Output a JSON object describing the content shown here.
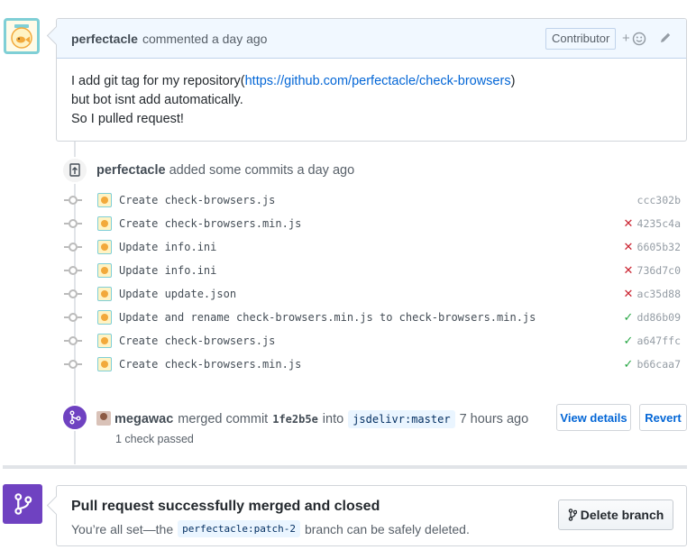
{
  "comment": {
    "author": "perfectacle",
    "meta": "commented a day ago",
    "badge": "Contributor",
    "react_plus": "+",
    "body_line1_prefix": "I add git tag for my repository(",
    "body_link": "https://github.com/perfectacle/check-browsers",
    "body_line1_suffix": ")",
    "body_line2": "but bot isnt add automatically.",
    "body_line3": "So I pulled request!"
  },
  "commit_event": {
    "author": "perfectacle",
    "text": "added some commits a day ago"
  },
  "commits": [
    {
      "message": "Create check-browsers.js",
      "status": "",
      "sha": "ccc302b"
    },
    {
      "message": "Create check-browsers.min.js",
      "status": "fail",
      "sha": "4235c4a"
    },
    {
      "message": "Update info.ini",
      "status": "fail",
      "sha": "6605b32"
    },
    {
      "message": "Update info.ini",
      "status": "fail",
      "sha": "736d7c0"
    },
    {
      "message": "Update update.json",
      "status": "fail",
      "sha": "ac35d88"
    },
    {
      "message": "Update and rename check-browsers.min.js to check-browsers.min.js",
      "status": "ok",
      "sha": "dd86b09"
    },
    {
      "message": "Create check-browsers.js",
      "status": "ok",
      "sha": "a647ffc"
    },
    {
      "message": "Create check-browsers.min.js",
      "status": "ok",
      "sha": "b66caa7"
    }
  ],
  "merge_event": {
    "author": "megawac",
    "action": "merged commit",
    "sha": "1fe2b5e",
    "into": "into",
    "branch": "jsdelivr:master",
    "time": "7 hours ago",
    "checks": "1 check passed",
    "view_details": "View details",
    "revert": "Revert"
  },
  "merged_box": {
    "title": "Pull request successfully merged and closed",
    "sub_prefix": "You’re all set—the",
    "branch": "perfectacle:patch-2",
    "sub_suffix": "branch can be safely deleted.",
    "delete_button": "Delete branch"
  },
  "colors": {
    "purple": "#6f42c1",
    "fail": "#cb2431",
    "ok": "#28a745",
    "link": "#0366d6"
  }
}
